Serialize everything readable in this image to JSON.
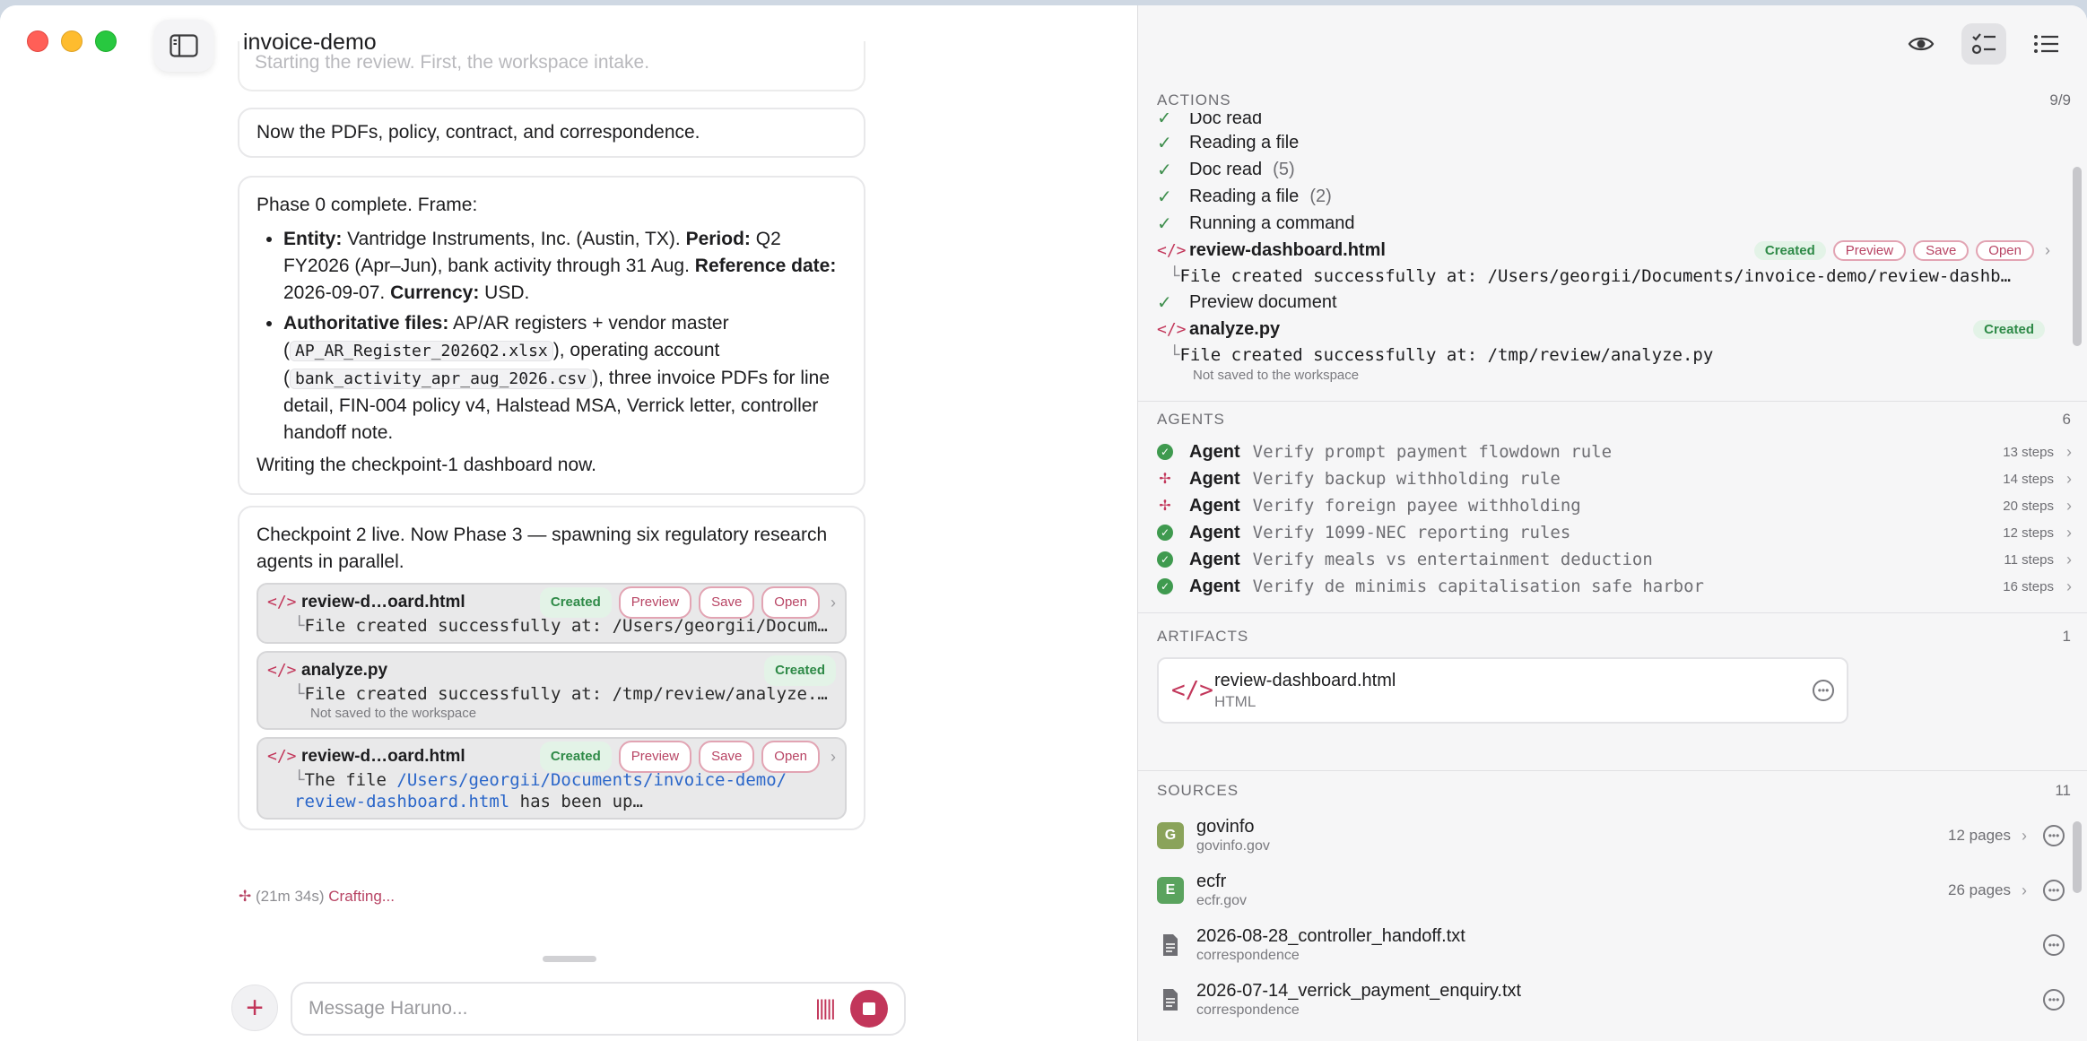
{
  "app": {
    "title": "invoice-demo"
  },
  "chat": {
    "faded_line": "Starting the review. First, the workspace intake.",
    "msg1": "Now the PDFs, policy, contract, and correspondence.",
    "msg2": {
      "intro": "Phase 0 complete. Frame:",
      "b1_entity_label": "Entity:",
      "b1_entity": "Vantridge Instruments, Inc. (Austin, TX).",
      "b1_period_label": "Period:",
      "b1_period": "Q2 FY2026 (Apr–Jun), bank activity through 31 Aug.",
      "b1_ref_label": "Reference date:",
      "b1_ref": "2026-09-07.",
      "b1_currency_label": "Currency:",
      "b1_currency": "USD.",
      "b2_label": "Authoritative files:",
      "b2_t1": "AP/AR registers + vendor master (",
      "b2_code1": "AP_AR_Register_2026Q2.xlsx",
      "b2_t2": "), operating account (",
      "b2_code2": "bank_activity_apr_aug_2026.csv",
      "b2_t3": "), three invoice PDFs for line detail, FIN-004 policy v4, Halstead MSA, Verrick letter, controller handoff note.",
      "outro": "Writing the checkpoint-1 dashboard now."
    },
    "msg3": {
      "text": "Checkpoint 2 live. Now Phase 3 — spawning six regulatory research agents in parallel.",
      "cards": [
        {
          "name": "review-d…oard.html",
          "badge": "Created",
          "preview": "Preview",
          "save": "Save",
          "open": "Open",
          "line": "File created successfully at: /Users/georgii/Docum…"
        },
        {
          "name": "analyze.py",
          "badge": "Created",
          "line": "File created successfully at: /tmp/review/analyze.…",
          "sub": "Not saved to the workspace"
        },
        {
          "name": "review-d…oard.html",
          "badge": "Created",
          "preview": "Preview",
          "save": "Save",
          "open": "Open",
          "line_a": "The file ",
          "line_link1": "/Users/georgii/Documents/invoice-demo/",
          "line_link2": "review-dashboard.html",
          "line_b": " has been up…"
        }
      ]
    },
    "status_elapsed": "(21m 34s)",
    "status_text": "Crafting...",
    "composer_placeholder": "Message Haruno..."
  },
  "panel": {
    "actions": {
      "title": "ACTIONS",
      "count": "9/9",
      "items": [
        {
          "label": "Doc read",
          "count": ""
        },
        {
          "label": "Reading a file",
          "count": ""
        },
        {
          "label": "Doc read",
          "count": "(5)"
        },
        {
          "label": "Reading a file",
          "count": "(2)"
        },
        {
          "label": "Running a command",
          "count": ""
        }
      ],
      "file1": {
        "name": "review-dashboard.html",
        "badge": "Created",
        "preview": "Preview",
        "save": "Save",
        "open": "Open",
        "line": "File created successfully at: /Users/georgii/Documents/invoice-demo/review-dashb…"
      },
      "preview_doc": "Preview document",
      "file2": {
        "name": "analyze.py",
        "badge": "Created",
        "line": "File created successfully at: /tmp/review/analyze.py",
        "sub": "Not saved to the workspace"
      }
    },
    "agents": {
      "title": "AGENTS",
      "count": "6",
      "items": [
        {
          "label": "Agent",
          "task": "Verify prompt payment flowdown rule",
          "steps": "13 steps",
          "status": "done"
        },
        {
          "label": "Agent",
          "task": "Verify backup withholding rule",
          "steps": "14 steps",
          "status": "running"
        },
        {
          "label": "Agent",
          "task": "Verify foreign payee withholding",
          "steps": "20 steps",
          "status": "running"
        },
        {
          "label": "Agent",
          "task": "Verify 1099-NEC reporting rules",
          "steps": "12 steps",
          "status": "done"
        },
        {
          "label": "Agent",
          "task": "Verify meals vs entertainment deduction",
          "steps": "11 steps",
          "status": "done"
        },
        {
          "label": "Agent",
          "task": "Verify de minimis capitalisation safe harbor",
          "steps": "16 steps",
          "status": "done"
        }
      ]
    },
    "artifacts": {
      "title": "ARTIFACTS",
      "count": "1",
      "item": {
        "name": "review-dashboard.html",
        "type": "HTML"
      }
    },
    "sources": {
      "title": "SOURCES",
      "count": "11",
      "items": [
        {
          "badge": "G",
          "name": "govinfo",
          "sub": "govinfo.gov",
          "pages": "12 pages",
          "color": "#8aa35a"
        },
        {
          "badge": "E",
          "name": "ecfr",
          "sub": "ecfr.gov",
          "pages": "26 pages",
          "color": "#5aa35e"
        },
        {
          "name": "2026-08-28_controller_handoff.txt",
          "sub": "correspondence"
        },
        {
          "name": "2026-07-14_verrick_payment_enquiry.txt",
          "sub": "correspondence"
        }
      ]
    }
  }
}
